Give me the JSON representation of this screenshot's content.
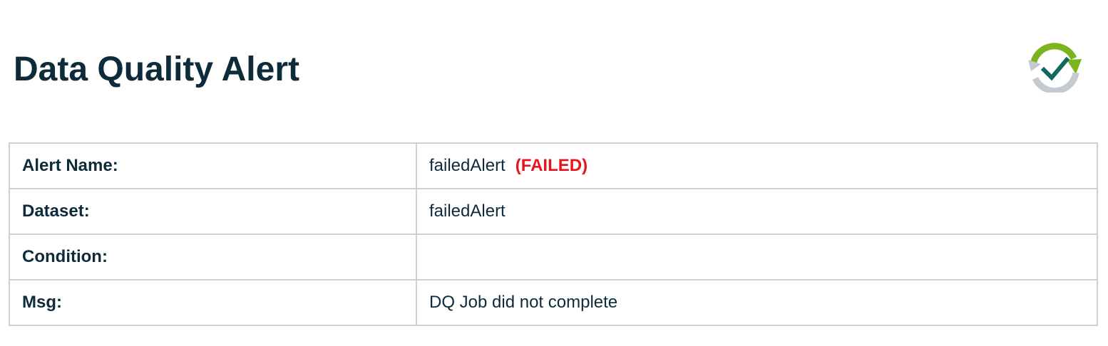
{
  "page_title": "Data Quality Alert",
  "logo": {
    "icon": "refresh-check-icon",
    "colors": {
      "arrow_green": "#7ab51d",
      "arrow_gray": "#c3cbd1",
      "check_teal": "#12695f"
    }
  },
  "rows": [
    {
      "label": "Alert Name:",
      "value": "failedAlert",
      "status": "(FAILED)"
    },
    {
      "label": "Dataset:",
      "value": "failedAlert"
    },
    {
      "label": "Condition:",
      "value": ""
    },
    {
      "label": "Msg:",
      "value": "DQ Job did not complete"
    }
  ],
  "colors": {
    "heading": "#0d2b3a",
    "status_failed": "#e8141c",
    "table_border": "#cfcfcf"
  }
}
